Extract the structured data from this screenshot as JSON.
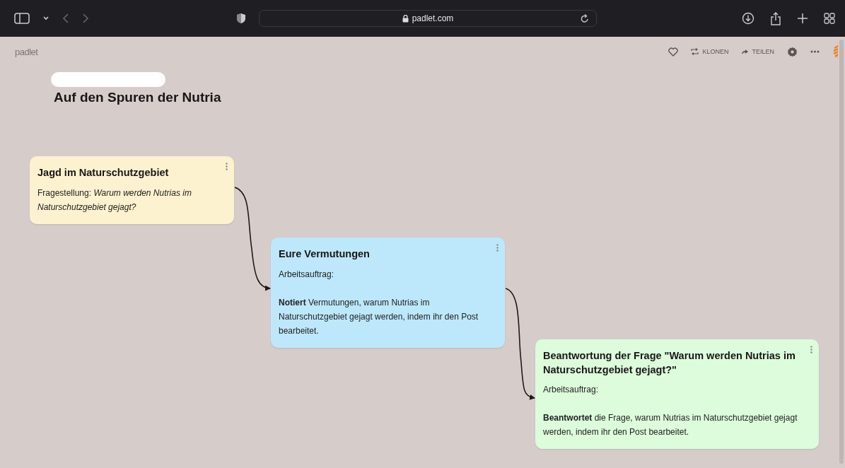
{
  "browser": {
    "address": "padlet.com"
  },
  "header": {
    "logo": "padlet",
    "actions": [
      {
        "kind": "like"
      },
      {
        "kind": "clone",
        "label": "KLONEN"
      },
      {
        "kind": "share",
        "label": "TEILEN"
      },
      {
        "kind": "settings"
      },
      {
        "kind": "more"
      }
    ]
  },
  "board": {
    "title": "Auf den Spuren der Nutria"
  },
  "posts": [
    {
      "title": "Jagd im Naturschutzgebiet",
      "color": "#fdf2cf",
      "paragraphs": [
        "Fragestellung: *Warum werden Nutrias im Naturschutzgebiet gejagt?*"
      ]
    },
    {
      "title": "Eure Vermutungen",
      "color": "#bde8fb",
      "paragraphs": [
        "Arbeitsauftrag:",
        "**Notiert** Vermutungen, warum Nutrias im Naturschutzgebiet gejagt werden, indem ihr den Post bearbeitet."
      ]
    },
    {
      "title": "Beantwortung der Frage \"Warum werden Nutrias im Naturschutzgebiet gejagt?\"",
      "color": "#dcfcdc",
      "paragraphs": [
        "Arbeitsauftrag:",
        "**Beantwortet** die Frage, warum Nutrias im Naturschutzgebiet gejagt werden, indem ihr den Post bearbeitet."
      ]
    }
  ]
}
